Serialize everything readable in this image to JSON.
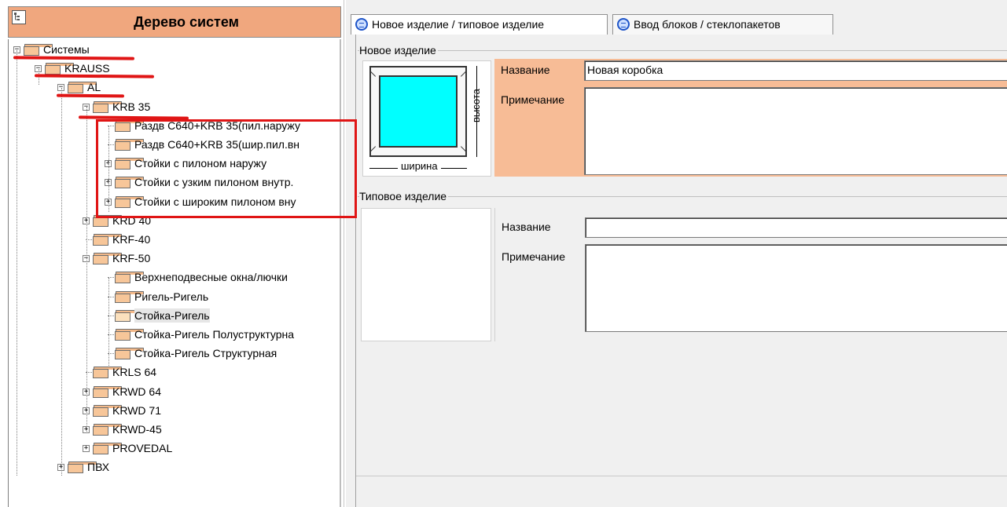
{
  "tree": {
    "title": "Дерево систем",
    "nodes": [
      {
        "label": "Системы",
        "depth": 0,
        "expander": "−"
      },
      {
        "label": "KRAUSS",
        "depth": 1,
        "expander": "−"
      },
      {
        "label": "AL",
        "depth": 2,
        "expander": "−"
      },
      {
        "label": "KRB 35",
        "depth": 3,
        "expander": "−"
      },
      {
        "label": "Раздв С640+KRB 35(пил.наружу",
        "depth": 4,
        "expander": ""
      },
      {
        "label": "Раздв С640+KRB 35(шир.пил.вн",
        "depth": 4,
        "expander": ""
      },
      {
        "label": "Стойки с пилоном наружу",
        "depth": 4,
        "expander": "+"
      },
      {
        "label": "Стойки с узким пилоном внутр.",
        "depth": 4,
        "expander": "+"
      },
      {
        "label": "Стойки с широким пилоном вну",
        "depth": 4,
        "expander": "+"
      },
      {
        "label": "KRD 40",
        "depth": 3,
        "expander": "+"
      },
      {
        "label": "KRF-40",
        "depth": 3,
        "expander": ""
      },
      {
        "label": "KRF-50",
        "depth": 3,
        "expander": "−"
      },
      {
        "label": "Верхнеподвесные окна/лючки",
        "depth": 4,
        "expander": ""
      },
      {
        "label": "Ригель-Ригель",
        "depth": 4,
        "expander": ""
      },
      {
        "label": "Стойка-Ригель",
        "depth": 4,
        "expander": "",
        "open": true,
        "selected": true
      },
      {
        "label": "Стойка-Ригель Полуструктурна",
        "depth": 4,
        "expander": ""
      },
      {
        "label": "Стойка-Ригель Структурная",
        "depth": 4,
        "expander": ""
      },
      {
        "label": "KRLS 64",
        "depth": 3,
        "expander": ""
      },
      {
        "label": "KRWD 64",
        "depth": 3,
        "expander": "+"
      },
      {
        "label": "KRWD 71",
        "depth": 3,
        "expander": "+"
      },
      {
        "label": "KRWD-45",
        "depth": 3,
        "expander": "+"
      },
      {
        "label": "PROVEDAL",
        "depth": 3,
        "expander": "+"
      },
      {
        "label": "ПВХ",
        "depth": 2,
        "expander": "+"
      }
    ]
  },
  "tabs": [
    {
      "label": "Новое изделие / типовое изделие",
      "active": true
    },
    {
      "label": "Ввод блоков / стеклопакетов",
      "active": false
    }
  ],
  "new_product": {
    "group_title": "Новое изделие",
    "width_label": "ширина",
    "height_label": "высота",
    "name_label": "Название",
    "name_value": "Новая коробка",
    "note_label": "Примечание",
    "note_value": ""
  },
  "typical_product": {
    "group_title": "Типовое изделие",
    "name_label": "Название",
    "name_value": "",
    "note_label": "Примечание",
    "note_value": ""
  },
  "colors": {
    "header_bg": "#f0a77e",
    "highlight_red": "#e01515",
    "preview_glass": "#00ffff",
    "orange_panel": "#f7bc96"
  }
}
